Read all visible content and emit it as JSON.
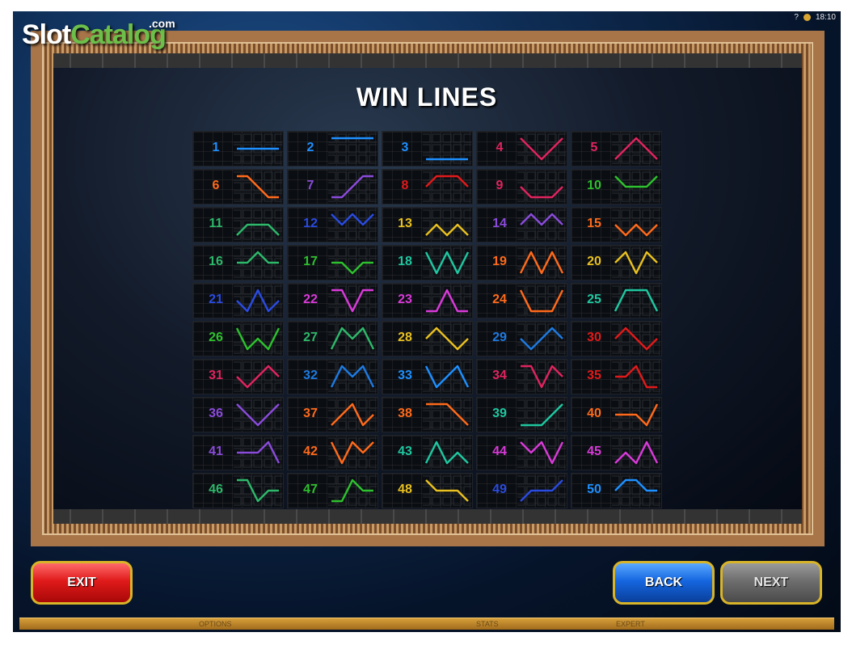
{
  "watermark": {
    "part1": "Slot",
    "part2": "Catalog",
    "part3": ".com"
  },
  "status": {
    "help": "?",
    "time": "18:10"
  },
  "title": "WIN LINES",
  "lines": [
    {
      "n": "1",
      "color": "#1e90ff",
      "path": [
        2,
        2,
        2,
        2,
        2
      ]
    },
    {
      "n": "2",
      "color": "#1e90ff",
      "path": [
        1,
        1,
        1,
        1,
        1
      ]
    },
    {
      "n": "3",
      "color": "#1e90ff",
      "path": [
        3,
        3,
        3,
        3,
        3
      ]
    },
    {
      "n": "4",
      "color": "#e0245e",
      "path": [
        1,
        2,
        3,
        2,
        1
      ]
    },
    {
      "n": "5",
      "color": "#e0245e",
      "path": [
        3,
        2,
        1,
        2,
        3
      ]
    },
    {
      "n": "6",
      "color": "#ff6a1a",
      "path": [
        1,
        1,
        2,
        3,
        3
      ]
    },
    {
      "n": "7",
      "color": "#8a4bd9",
      "path": [
        3,
        3,
        2,
        1,
        1
      ]
    },
    {
      "n": "8",
      "color": "#e01a1a",
      "path": [
        2,
        1,
        1,
        1,
        2
      ]
    },
    {
      "n": "9",
      "color": "#e0245e",
      "path": [
        2,
        3,
        3,
        3,
        2
      ]
    },
    {
      "n": "10",
      "color": "#2ec02e",
      "path": [
        1,
        2,
        2,
        2,
        1
      ]
    },
    {
      "n": "11",
      "color": "#2eb86a",
      "path": [
        3,
        2,
        2,
        2,
        3
      ]
    },
    {
      "n": "12",
      "color": "#2a4be0",
      "path": [
        1,
        2,
        1,
        2,
        1
      ]
    },
    {
      "n": "13",
      "color": "#e8c020",
      "path": [
        3,
        2,
        3,
        2,
        3
      ]
    },
    {
      "n": "14",
      "color": "#8a4bd9",
      "path": [
        2,
        1,
        2,
        1,
        2
      ]
    },
    {
      "n": "15",
      "color": "#ff6a1a",
      "path": [
        2,
        3,
        2,
        3,
        2
      ]
    },
    {
      "n": "16",
      "color": "#2eb86a",
      "path": [
        2,
        2,
        1,
        2,
        2
      ]
    },
    {
      "n": "17",
      "color": "#2ec02e",
      "path": [
        2,
        2,
        3,
        2,
        2
      ]
    },
    {
      "n": "18",
      "color": "#1fc7a0",
      "path": [
        1,
        3,
        1,
        3,
        1
      ]
    },
    {
      "n": "19",
      "color": "#ff6a1a",
      "path": [
        3,
        1,
        3,
        1,
        3
      ]
    },
    {
      "n": "20",
      "color": "#e8c020",
      "path": [
        2,
        1,
        3,
        1,
        2
      ]
    },
    {
      "n": "21",
      "color": "#2a4be0",
      "path": [
        2,
        3,
        1,
        3,
        2
      ]
    },
    {
      "n": "22",
      "color": "#d93ad9",
      "path": [
        1,
        1,
        3,
        1,
        1
      ]
    },
    {
      "n": "23",
      "color": "#d93ad9",
      "path": [
        3,
        3,
        1,
        3,
        3
      ]
    },
    {
      "n": "24",
      "color": "#ff6a1a",
      "path": [
        1,
        3,
        3,
        3,
        1
      ]
    },
    {
      "n": "25",
      "color": "#1fc7a0",
      "path": [
        3,
        1,
        1,
        1,
        3
      ]
    },
    {
      "n": "26",
      "color": "#2ec02e",
      "path": [
        1,
        3,
        2,
        3,
        1
      ]
    },
    {
      "n": "27",
      "color": "#2eb86a",
      "path": [
        3,
        1,
        2,
        1,
        3
      ]
    },
    {
      "n": "28",
      "color": "#e8c020",
      "path": [
        2,
        1,
        2,
        3,
        2
      ]
    },
    {
      "n": "29",
      "color": "#1e7ae0",
      "path": [
        2,
        3,
        2,
        1,
        2
      ]
    },
    {
      "n": "30",
      "color": "#e01a1a",
      "path": [
        2,
        1,
        2,
        3,
        2
      ]
    },
    {
      "n": "31",
      "color": "#e0245e",
      "path": [
        2,
        3,
        2,
        1,
        2
      ]
    },
    {
      "n": "32",
      "color": "#1e7ae0",
      "path": [
        3,
        1,
        2,
        1,
        3
      ]
    },
    {
      "n": "33",
      "color": "#1e90ff",
      "path": [
        1,
        3,
        2,
        1,
        3
      ]
    },
    {
      "n": "34",
      "color": "#e0245e",
      "path": [
        1,
        1,
        3,
        1,
        2
      ]
    },
    {
      "n": "35",
      "color": "#e01a1a",
      "path": [
        2,
        2,
        1,
        3,
        3
      ]
    },
    {
      "n": "36",
      "color": "#8a4bd9",
      "path": [
        1,
        2,
        3,
        2,
        1
      ]
    },
    {
      "n": "37",
      "color": "#ff6a1a",
      "path": [
        3,
        2,
        1,
        3,
        2
      ]
    },
    {
      "n": "38",
      "color": "#ff6a1a",
      "path": [
        1,
        1,
        1,
        2,
        3
      ]
    },
    {
      "n": "39",
      "color": "#1fc7a0",
      "path": [
        3,
        3,
        3,
        2,
        1
      ]
    },
    {
      "n": "40",
      "color": "#ff6a1a",
      "path": [
        2,
        2,
        2,
        3,
        1
      ]
    },
    {
      "n": "41",
      "color": "#8a4bd9",
      "path": [
        2,
        2,
        2,
        1,
        3
      ]
    },
    {
      "n": "42",
      "color": "#ff6a1a",
      "path": [
        1,
        3,
        1,
        2,
        1
      ]
    },
    {
      "n": "43",
      "color": "#1fc7a0",
      "path": [
        3,
        1,
        3,
        2,
        3
      ]
    },
    {
      "n": "44",
      "color": "#d93ad9",
      "path": [
        1,
        2,
        1,
        3,
        1
      ]
    },
    {
      "n": "45",
      "color": "#d93ad9",
      "path": [
        3,
        2,
        3,
        1,
        3
      ]
    },
    {
      "n": "46",
      "color": "#2eb86a",
      "path": [
        1,
        1,
        3,
        2,
        2
      ]
    },
    {
      "n": "47",
      "color": "#2ec02e",
      "path": [
        3,
        3,
        1,
        2,
        2
      ]
    },
    {
      "n": "48",
      "color": "#e8c020",
      "path": [
        1,
        2,
        2,
        2,
        3
      ]
    },
    {
      "n": "49",
      "color": "#2a4be0",
      "path": [
        3,
        2,
        2,
        2,
        1
      ]
    },
    {
      "n": "50",
      "color": "#1e90ff",
      "path": [
        2,
        1,
        1,
        2,
        2
      ]
    }
  ],
  "buttons": {
    "exit": "EXIT",
    "back": "BACK",
    "next": "NEXT"
  },
  "bottom_bar": {
    "options": "OPTIONS",
    "stats": "STATS",
    "expert": "EXPERT"
  }
}
